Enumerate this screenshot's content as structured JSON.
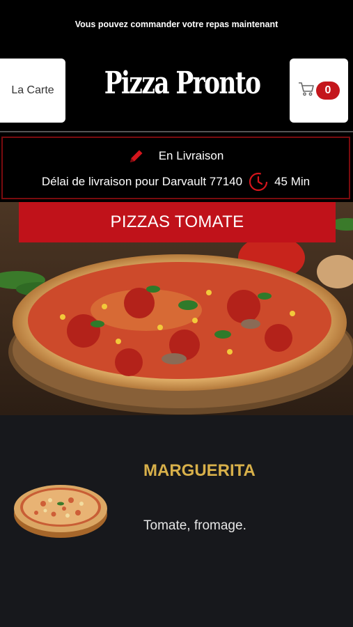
{
  "top_banner": "Vous pouvez commander votre repas maintenant",
  "header": {
    "menu_button": "La Carte",
    "logo": "Pizza Pronto",
    "cart_count": "0"
  },
  "delivery": {
    "mode": "En Livraison",
    "zone_text": "Délai de livraison pour Darvault 77140",
    "time": "45 Min"
  },
  "category": "PIZZAS TOMATE",
  "product": {
    "name": "MARGUERITA",
    "description": "Tomate, fromage."
  },
  "colors": {
    "accent_red": "#c0121a",
    "gold": "#d8b04a",
    "background": "#000000",
    "panel": "#17181c"
  },
  "icons": [
    "pencil-icon",
    "cart-icon",
    "clock-icon"
  ]
}
